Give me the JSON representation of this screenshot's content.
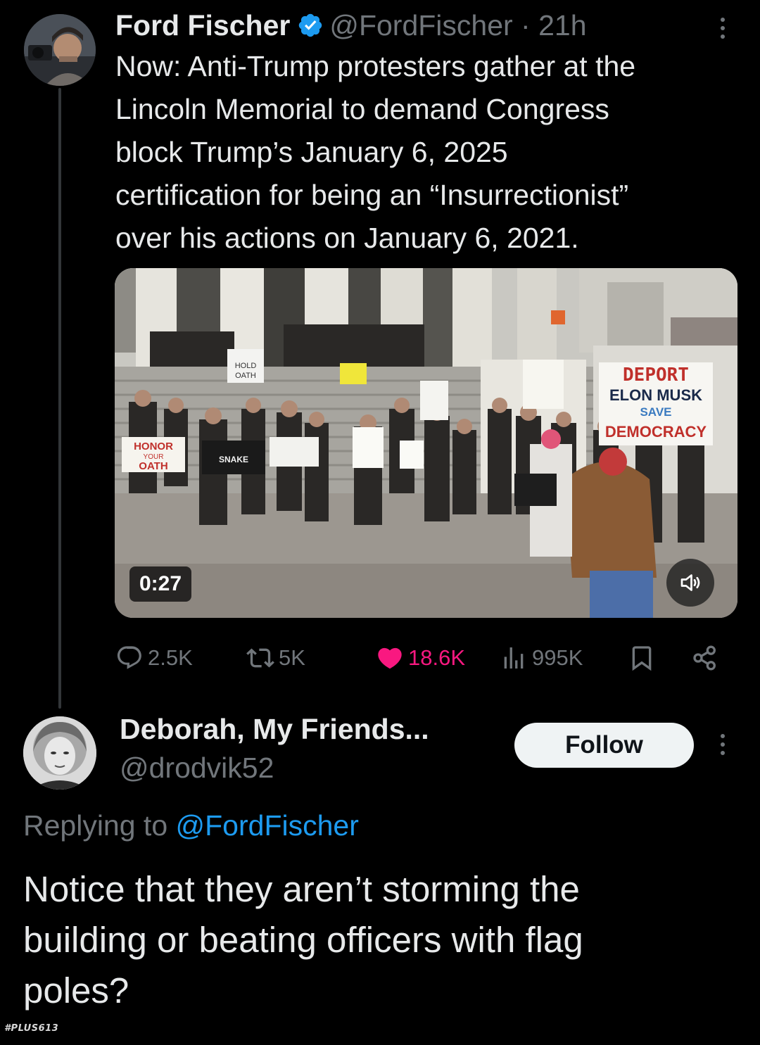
{
  "tweet": {
    "author": {
      "display_name": "Ford Fischer",
      "handle_time": "@FordFischer · 21h",
      "verified": true
    },
    "text": "Now: Anti-Trump protesters gather at the\nLincoln Memorial to demand Congress\nblock Trump’s January 6, 2025\ncertification for being an “Insurrectionist”\nover his actions on January 6, 2021.",
    "media": {
      "type": "video",
      "duration": "0:27",
      "signs": {
        "hold": "HOLD",
        "oath": "OATH",
        "honor_line1": "HONOR",
        "honor_line2": "YOUR",
        "honor_line3": "OATH",
        "snake": "SNAKE",
        "deport_line1": "DEPORT",
        "deport_line2": "ELON MUSK",
        "deport_line3": "SAVE",
        "deport_line4": "DEMOCRACY"
      }
    },
    "metrics": {
      "replies": "2.5K",
      "reposts": "5K",
      "likes": "18.6K",
      "views": "995K"
    },
    "icons": [
      "verified-badge-icon",
      "more-icon",
      "reply-icon",
      "repost-icon",
      "heart-icon",
      "views-icon",
      "bookmark-icon",
      "share-icon",
      "volume-icon"
    ]
  },
  "reply": {
    "author": {
      "display_name": "Deborah, My Friends...",
      "handle": "@drodvik52"
    },
    "follow_label": "Follow",
    "replying_prefix": "Replying to ",
    "replying_to": "@FordFischer",
    "text": "Notice that they aren’t storming the\nbuilding or beating officers with flag\npoles?"
  },
  "watermark": "#PLUS613",
  "colors": {
    "background": "#000000",
    "text_primary": "#e7e9ea",
    "text_secondary": "#71767b",
    "link": "#1d9bf0",
    "like": "#f91880",
    "verified": "#1d9bf0",
    "follow_bg": "#eff3f4"
  }
}
